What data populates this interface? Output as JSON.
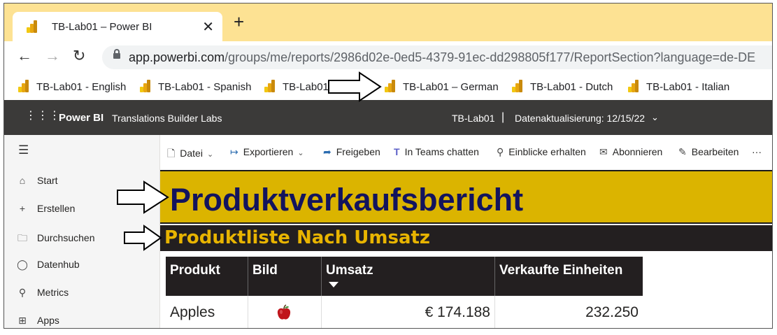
{
  "browser": {
    "tab": {
      "title": "TB-Lab01 – Power BI",
      "close": "✕"
    },
    "new_tab": "+",
    "url": {
      "host": "app.powerbi.com",
      "path": "/groups/me/reports/2986d02e-0ed5-4379-91ec-dd298805f177/ReportSection?language=de-DE"
    },
    "bookmarks": [
      {
        "label": "TB-Lab01 - English"
      },
      {
        "label": "TB-Lab01 - Spanish"
      },
      {
        "label": "TB-Lab01"
      },
      {
        "label": "TB-Lab01 – German"
      },
      {
        "label": "TB-Lab01 - Dutch"
      },
      {
        "label": "TB-Lab01 - Italian"
      }
    ]
  },
  "pbi_header": {
    "brand": "Power BI",
    "workspace": "Translations Builder Labs",
    "report_name": "TB-Lab01",
    "separator": "|",
    "refresh_label": "Datenaktualisierung: 12/15/22"
  },
  "leftnav": {
    "items": [
      {
        "label": "Start",
        "icon": "home-icon"
      },
      {
        "label": "Erstellen",
        "icon": "plus-icon"
      },
      {
        "label": "Durchsuchen",
        "icon": "folder-icon"
      },
      {
        "label": "Datenhub",
        "icon": "database-icon"
      },
      {
        "label": "Metrics",
        "icon": "trophy-icon"
      },
      {
        "label": "Apps",
        "icon": "apps-icon"
      }
    ]
  },
  "actionbar": {
    "file": "Datei",
    "export": "Exportieren",
    "share": "Freigeben",
    "teams": "In Teams chatten",
    "insights": "Einblicke erhalten",
    "subscribe": "Abonnieren",
    "edit": "Bearbeiten",
    "more": "···"
  },
  "report": {
    "title": "Produktverkaufsbericht",
    "subtitle": "Produktliste Nach Umsatz",
    "table": {
      "columns": [
        "Produkt",
        "Bild",
        "Umsatz",
        "Verkaufte Einheiten"
      ],
      "sorted_column": "Umsatz",
      "rows": [
        {
          "product": "Apples",
          "image": "apple-icon",
          "revenue": "€ 174.188",
          "units": "232.250"
        }
      ]
    }
  },
  "colors": {
    "tabbar": "#fde293",
    "title_bg": "#dbb400",
    "title_text": "#13145d",
    "subtitle_text": "#e8b400",
    "dark": "#231f20"
  }
}
